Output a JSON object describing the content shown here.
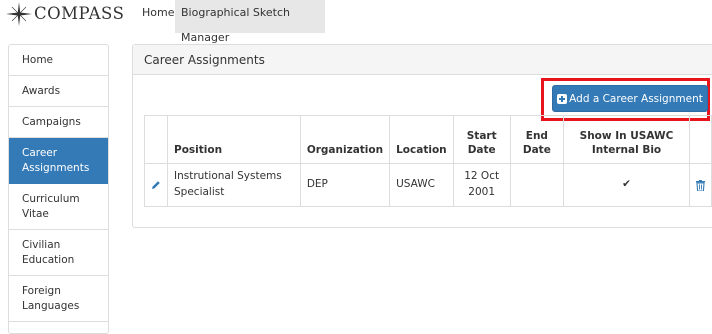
{
  "header": {
    "logo_text": "COMPASS",
    "nav": [
      {
        "label": "Home"
      },
      {
        "label": "Biographical Sketch Manager"
      }
    ]
  },
  "sidebar": {
    "items": [
      {
        "label": "Home",
        "active": false
      },
      {
        "label": "Awards",
        "active": false
      },
      {
        "label": "Campaigns",
        "active": false
      },
      {
        "label": "Career Assignments",
        "active": true
      },
      {
        "label": "Curriculum Vitae",
        "active": false
      },
      {
        "label": "Civilian Education",
        "active": false
      },
      {
        "label": "Foreign Languages",
        "active": false
      }
    ]
  },
  "panel": {
    "title": "Career Assignments",
    "add_button_label": "Add a Career Assignment",
    "add_button_icon": "plus-square-icon"
  },
  "table": {
    "columns": [
      "",
      "Position",
      "Organization",
      "Location",
      "Start Date",
      "End Date",
      "Show In USAWC Internal Bio",
      ""
    ],
    "rows": [
      {
        "position": "Instrutional Systems Specialist",
        "organization": "DEP",
        "location": "USAWC",
        "start_date": "12 Oct 2001",
        "end_date": "",
        "show_in_bio_mark": "✔",
        "edit_icon": "pencil-icon",
        "delete_icon": "trash-icon"
      }
    ]
  },
  "colors": {
    "primary": "#337ab7",
    "highlight": "#e8141b",
    "nav_active_bg": "#e7e7e7"
  }
}
